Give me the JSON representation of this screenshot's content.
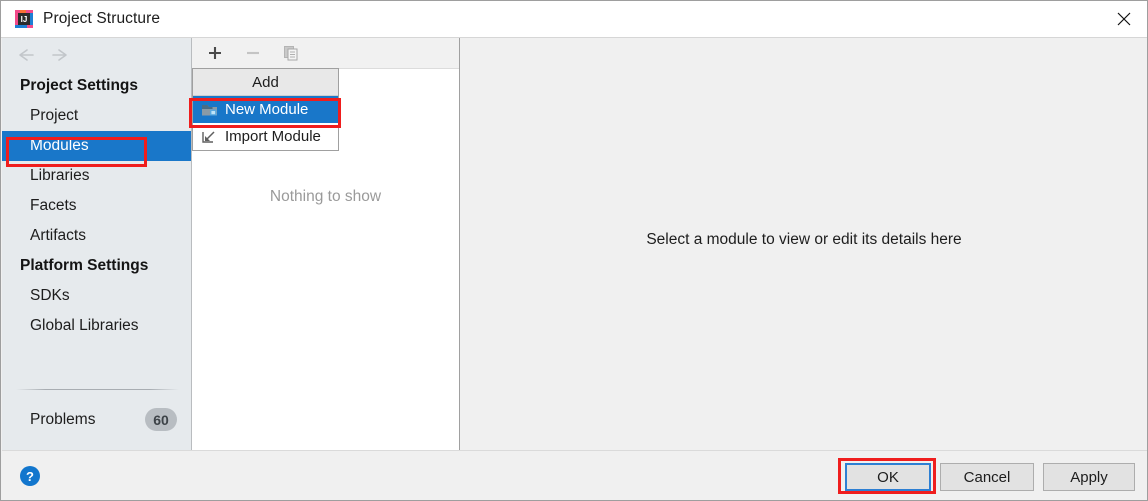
{
  "window": {
    "title": "Project Structure",
    "app_icon": "intellij-idea-logo-icon",
    "close_icon": "close-icon"
  },
  "sidebar": {
    "back_icon": "arrow-left-icon",
    "forward_icon": "arrow-right-icon",
    "groups": [
      {
        "label": "Project Settings",
        "items": [
          {
            "label": "Project",
            "selected": false
          },
          {
            "label": "Modules",
            "selected": true
          },
          {
            "label": "Libraries",
            "selected": false
          },
          {
            "label": "Facets",
            "selected": false
          },
          {
            "label": "Artifacts",
            "selected": false
          }
        ]
      },
      {
        "label": "Platform Settings",
        "items": [
          {
            "label": "SDKs",
            "selected": false
          },
          {
            "label": "Global Libraries",
            "selected": false
          }
        ]
      }
    ],
    "problems": {
      "label": "Problems",
      "count": "60"
    }
  },
  "modules_panel": {
    "toolbar": {
      "add_icon": "plus-icon",
      "remove_icon": "minus-icon",
      "copy_icon": "copy-icon"
    },
    "empty_text": "Nothing to show"
  },
  "add_menu": {
    "title": "Add",
    "items": [
      {
        "label": "New Module",
        "icon": "module-folder-icon",
        "highlighted": true
      },
      {
        "label": "Import Module",
        "icon": "import-arrow-icon",
        "highlighted": false
      }
    ]
  },
  "detail_panel": {
    "message": "Select a module to view or edit its details here"
  },
  "footer": {
    "help_icon": "help-circle-icon",
    "ok_label": "OK",
    "cancel_label": "Cancel",
    "apply_label": "Apply"
  },
  "annotations": {
    "accent_red": "#ef1d1d",
    "selection_blue": "#1977c9",
    "focus_blue": "#2d7fd3"
  }
}
